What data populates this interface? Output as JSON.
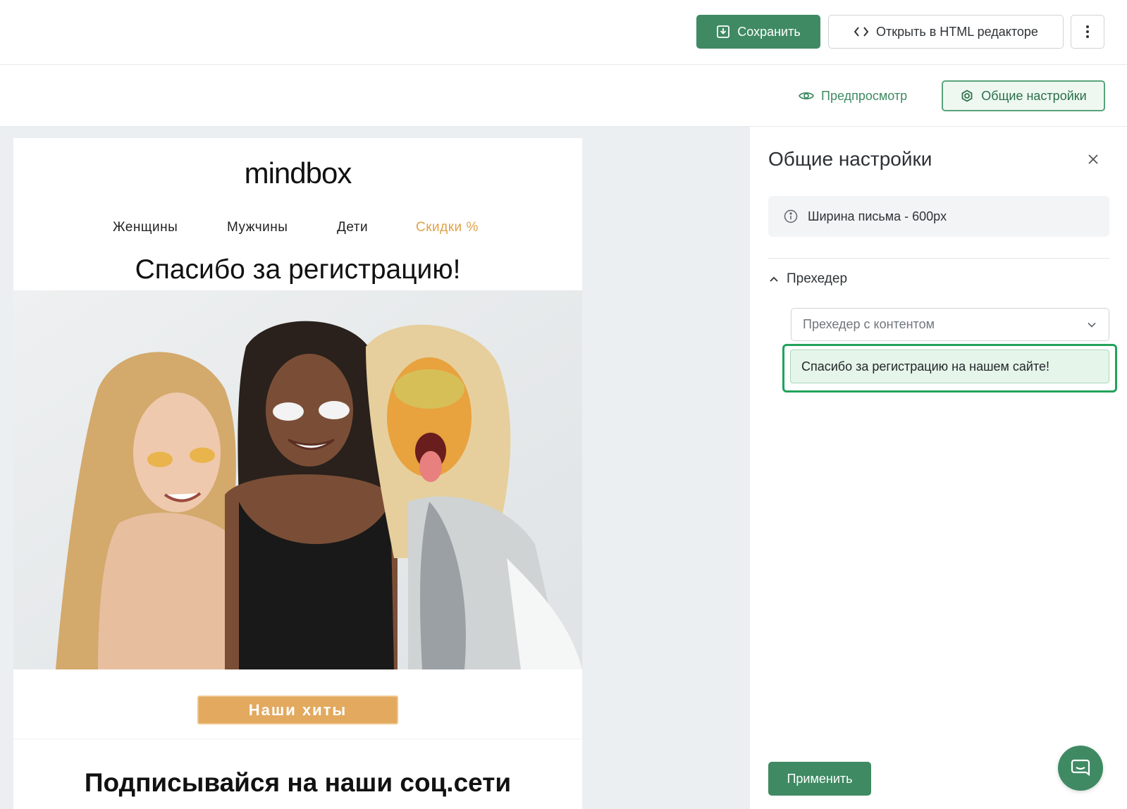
{
  "toolbar": {
    "save_label": "Сохранить",
    "html_editor_label": "Открыть в HTML редакторе",
    "more_icon": "kebab-vertical-icon"
  },
  "subbar": {
    "preview_label": "Предпросмотр",
    "general_settings_label": "Общие настройки"
  },
  "email": {
    "logo": "mindbox",
    "nav": [
      "Женщины",
      "Мужчины",
      "Дети",
      "Скидки %"
    ],
    "headline": "Спасибо за регистрацию!",
    "cta_label": "Наши хиты",
    "social_title": "Подписывайся на наши соц.сети"
  },
  "panel": {
    "title": "Общие настройки",
    "info_text": "Ширина письма - 600px",
    "section_label": "Прехедер",
    "select_value": "Прехедер с контентом",
    "preheader_text": "Спасибо за регистрацию на нашем сайте!",
    "apply_label": "Применить"
  },
  "colors": {
    "primary_green": "#3f8a63",
    "highlight_green": "#22a35a",
    "sale_orange": "#e0a24a",
    "cta_orange": "#e2a95f",
    "canvas_bg": "#eceff1"
  }
}
